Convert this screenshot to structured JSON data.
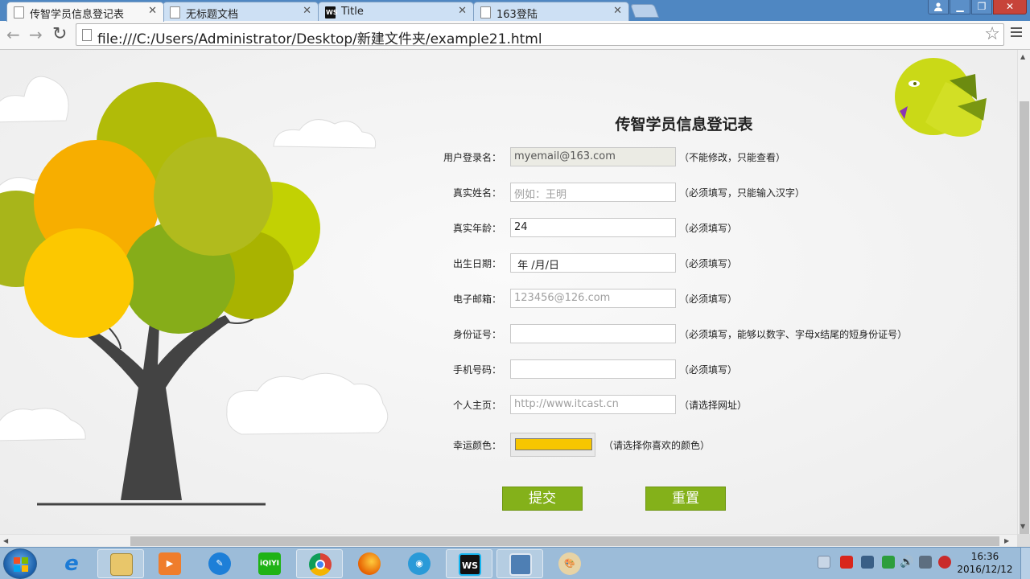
{
  "browser": {
    "tabs": [
      {
        "label": "传智学员信息登记表",
        "active": true
      },
      {
        "label": "无标题文档",
        "active": false
      },
      {
        "label": "Title",
        "active": false
      },
      {
        "label": "163登陆",
        "active": false
      }
    ],
    "url": "file:///C:/Users/Administrator/Desktop/新建文件夹/example21.html"
  },
  "form": {
    "title": "传智学员信息登记表",
    "fields": [
      {
        "label": "用户登录名：",
        "value": "myemail@163.com",
        "placeholder": "",
        "note": "（不能修改，只能查看）",
        "readonly": true
      },
      {
        "label": "真实姓名：",
        "value": "",
        "placeholder": "例如：王明",
        "note": "（必须填写，只能输入汉字）"
      },
      {
        "label": "真实年龄：",
        "value": "24",
        "placeholder": "",
        "note": "（必须填写）"
      },
      {
        "label": "出生日期：",
        "value": " 年 /月/日",
        "placeholder": "",
        "note": "（必须填写）"
      },
      {
        "label": "电子邮箱：",
        "value": "",
        "placeholder": "123456@126.com",
        "note": "（必须填写）"
      },
      {
        "label": "身份证号：",
        "value": "",
        "placeholder": "",
        "note": "（必须填写，能够以数字、字母x结尾的短身份证号）"
      },
      {
        "label": "手机号码：",
        "value": "",
        "placeholder": "",
        "note": "（必须填写）"
      },
      {
        "label": "个人主页：",
        "value": "",
        "placeholder": "http://www.itcast.cn",
        "note": "（请选择网址）"
      }
    ],
    "color_field": {
      "label": "幸运颜色：",
      "value": "#f7c600",
      "note": "（请选择你喜欢的颜色）"
    },
    "submit_label": "提交",
    "reset_label": "重置"
  },
  "taskbar": {
    "time": "16:36",
    "date": "2016/12/12"
  }
}
